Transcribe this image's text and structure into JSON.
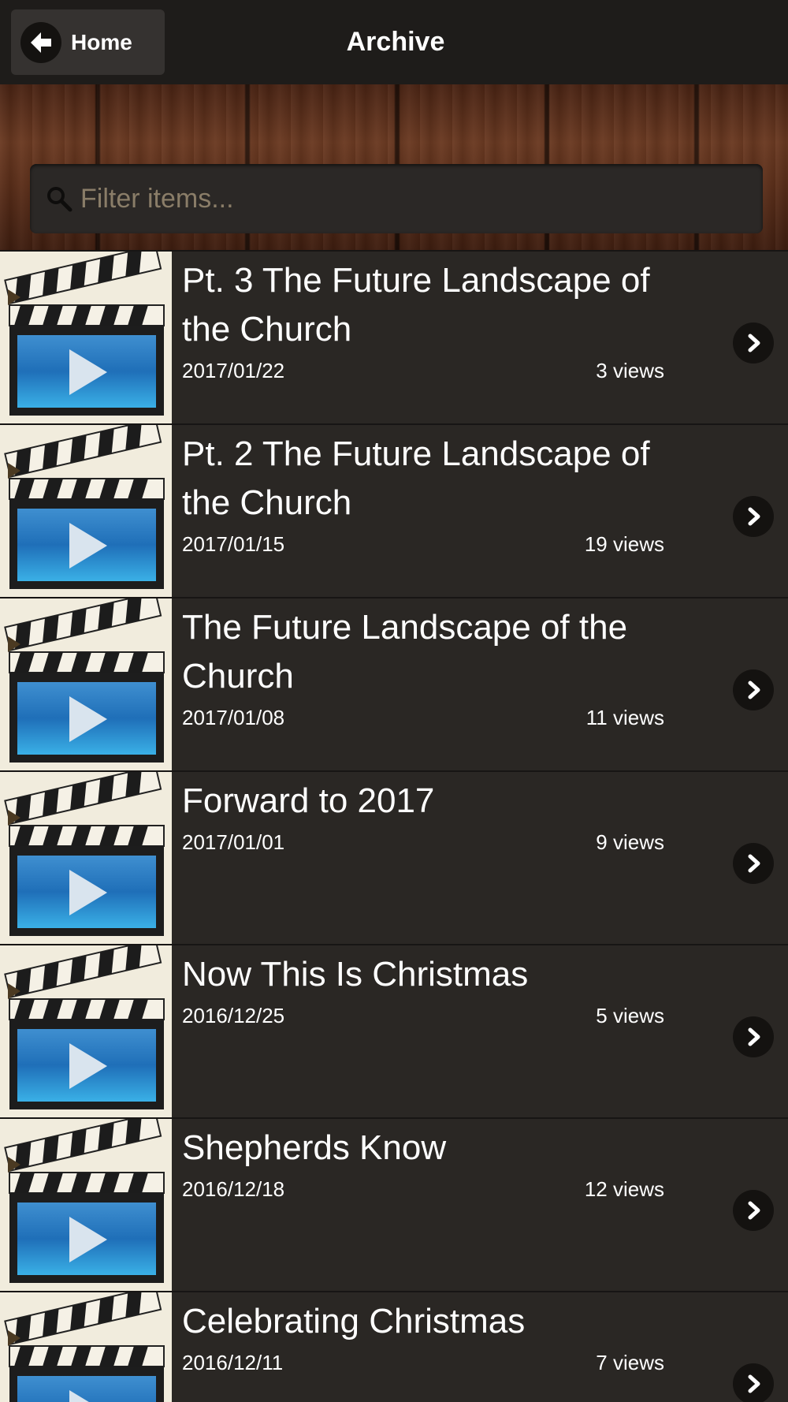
{
  "header": {
    "title": "Archive",
    "home_label": "Home"
  },
  "search": {
    "placeholder": "Filter items..."
  },
  "items": [
    {
      "title": "Pt. 3 The Future Landscape of the Church",
      "date": "2017/01/22",
      "views": "3 views"
    },
    {
      "title": "Pt. 2 The Future Landscape of the Church",
      "date": "2017/01/15",
      "views": "19 views"
    },
    {
      "title": "The Future Landscape of the Church",
      "date": "2017/01/08",
      "views": "11 views"
    },
    {
      "title": "Forward to 2017",
      "date": "2017/01/01",
      "views": "9 views"
    },
    {
      "title": "Now This Is Christmas",
      "date": "2016/12/25",
      "views": "5 views"
    },
    {
      "title": "Shepherds Know",
      "date": "2016/12/18",
      "views": "12 views"
    },
    {
      "title": "Celebrating Christmas",
      "date": "2016/12/11",
      "views": "7 views"
    }
  ],
  "icons": {
    "back": "arrow-left-icon",
    "search": "search-icon",
    "chevron": "chevron-right-icon",
    "thumbnail": "video-clapperboard-icon"
  },
  "colors": {
    "header_bg": "#1e1c1a",
    "list_bg": "#2a2724",
    "placeholder": "#8a7d68"
  }
}
